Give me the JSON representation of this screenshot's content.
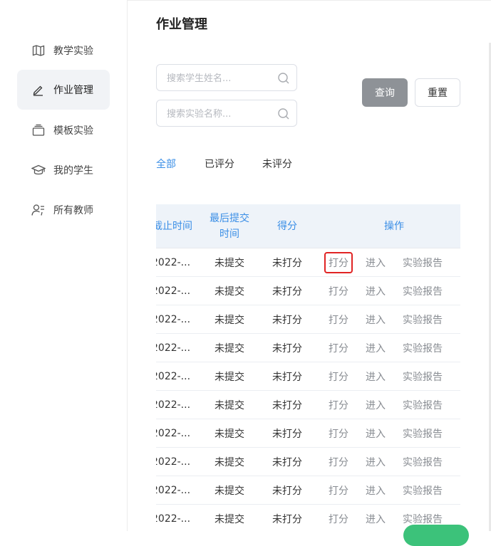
{
  "sidebar": {
    "items": [
      {
        "label": "教学实验",
        "icon": "book-icon"
      },
      {
        "label": "作业管理",
        "icon": "pencil-icon",
        "active": true
      },
      {
        "label": "模板实验",
        "icon": "template-icon"
      },
      {
        "label": "我的学生",
        "icon": "graduation-cap-icon"
      },
      {
        "label": "所有教师",
        "icon": "teacher-icon"
      }
    ]
  },
  "page": {
    "title": "作业管理"
  },
  "search": {
    "student_placeholder": "搜索学生姓名...",
    "student_value": "",
    "experiment_placeholder": "搜索实验名称...",
    "experiment_value": ""
  },
  "buttons": {
    "query": "查询",
    "reset": "重置"
  },
  "tabs": [
    {
      "label": "全部",
      "active": true
    },
    {
      "label": "已评分"
    },
    {
      "label": "未评分"
    }
  ],
  "table": {
    "headers": {
      "deadline": "截止时间",
      "last_submit_line1": "最后提交",
      "last_submit_line2": "时间",
      "score": "得分",
      "actions": "操作"
    },
    "rows": [
      {
        "deadline": "2022-...",
        "last_submit": "未提交",
        "score": "未打分",
        "grade": "打分",
        "enter": "进入",
        "report": "实验报告"
      },
      {
        "deadline": "2022-...",
        "last_submit": "未提交",
        "score": "未打分",
        "grade": "打分",
        "enter": "进入",
        "report": "实验报告"
      },
      {
        "deadline": "2022-...",
        "last_submit": "未提交",
        "score": "未打分",
        "grade": "打分",
        "enter": "进入",
        "report": "实验报告"
      },
      {
        "deadline": "2022-...",
        "last_submit": "未提交",
        "score": "未打分",
        "grade": "打分",
        "enter": "进入",
        "report": "实验报告"
      },
      {
        "deadline": "2022-...",
        "last_submit": "未提交",
        "score": "未打分",
        "grade": "打分",
        "enter": "进入",
        "report": "实验报告"
      },
      {
        "deadline": "2022-...",
        "last_submit": "未提交",
        "score": "未打分",
        "grade": "打分",
        "enter": "进入",
        "report": "实验报告"
      },
      {
        "deadline": "2022-...",
        "last_submit": "未提交",
        "score": "未打分",
        "grade": "打分",
        "enter": "进入",
        "report": "实验报告"
      },
      {
        "deadline": "2022-...",
        "last_submit": "未提交",
        "score": "未打分",
        "grade": "打分",
        "enter": "进入",
        "report": "实验报告"
      },
      {
        "deadline": "2022-...",
        "last_submit": "未提交",
        "score": "未打分",
        "grade": "打分",
        "enter": "进入",
        "report": "实验报告"
      },
      {
        "deadline": "2022-...",
        "last_submit": "未提交",
        "score": "未打分",
        "grade": "打分",
        "enter": "进入",
        "report": "实验报告"
      }
    ]
  },
  "colors": {
    "accent": "#3a8ee6",
    "query_button": "#8e9297",
    "highlight": "#e02424",
    "active_nav_bg": "#f1f3f6"
  }
}
